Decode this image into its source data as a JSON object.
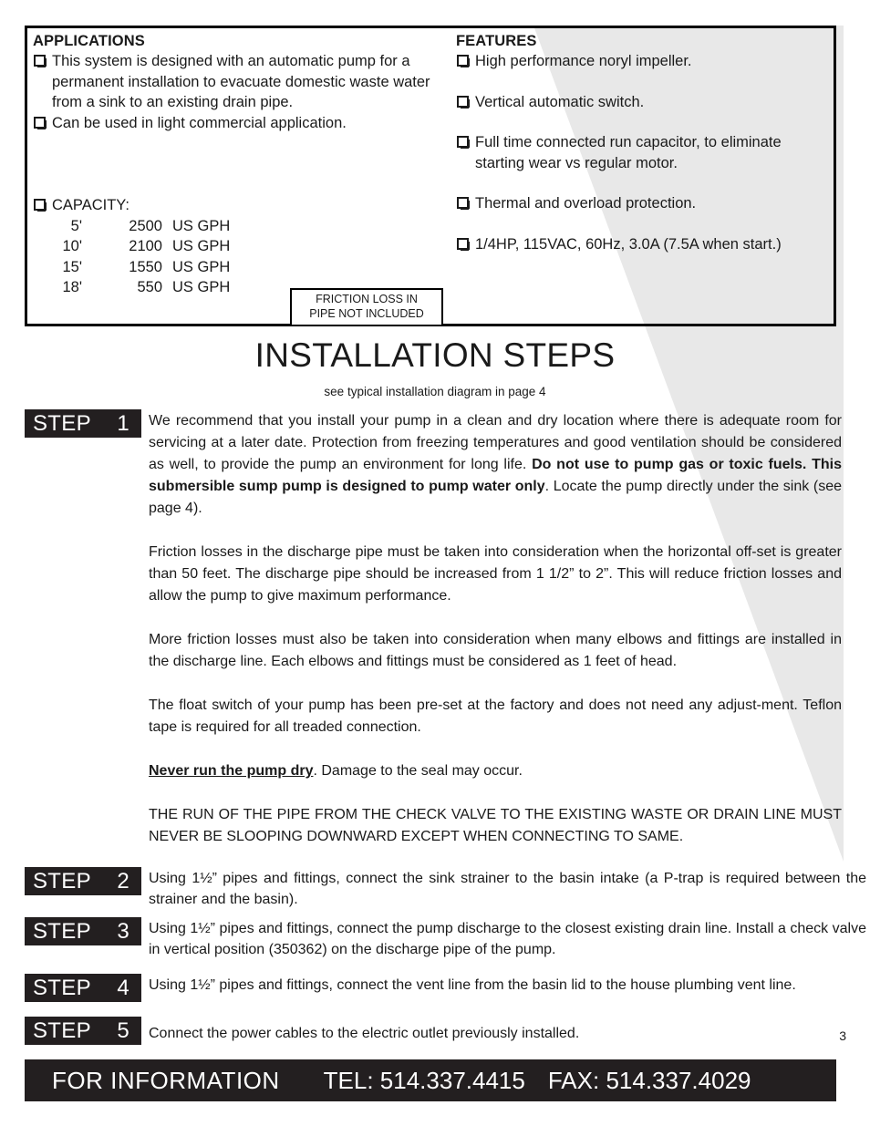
{
  "spec_box": {
    "applications": {
      "heading": "APPLICATIONS",
      "items": [
        "This system is designed with an automatic pump for a permanent installation to evacuate domestic waste water from a sink to an existing drain pipe.",
        "Can be used in light commercial application."
      ],
      "capacity_label": "CAPACITY:",
      "capacity_rows": [
        {
          "head": "5'",
          "value": "2500",
          "unit": "US GPH"
        },
        {
          "head": "10'",
          "value": "2100",
          "unit": "US GPH"
        },
        {
          "head": "15'",
          "value": "1550",
          "unit": "US GPH"
        },
        {
          "head": "18'",
          "value": "550",
          "unit": "US GPH"
        }
      ],
      "friction_note_line1": "FRICTION LOSS IN",
      "friction_note_line2": "PIPE NOT INCLUDED"
    },
    "features": {
      "heading": "FEATURES",
      "items": [
        "High performance noryl impeller.",
        "Vertical automatic switch.",
        "Full time connected run capacitor, to eliminate starting wear vs regular motor.",
        "Thermal and overload protection.",
        "1/4HP, 115VAC, 60Hz, 3.0A (7.5A when start.)"
      ]
    }
  },
  "title": {
    "main": "INSTALLATION STEPS",
    "sub": "see typical installation diagram in page 4"
  },
  "steps": {
    "word": "STEP",
    "step1": {
      "number": "1",
      "paragraphs": [
        {
          "runs": [
            {
              "text": "We recommend that you install your pump in a clean and dry location where there is adequate room for servicing at a later date. Protection from freezing temperatures and good ventilation should be considered as well, to provide the pump an environment for long life. ",
              "style": "normal"
            },
            {
              "text": "Do not use to pump gas or toxic fuels. This submersible sump pump is designed to pump water only",
              "style": "bold"
            },
            {
              "text": ". Locate the pump directly under the sink (see page 4).",
              "style": "normal"
            }
          ]
        },
        {
          "runs": [
            {
              "text": "Friction losses in the discharge pipe must be taken into consideration when the horizontal off-set is greater than 50 feet. The discharge pipe should be increased from 1 1/2” to 2”. This will reduce friction losses and allow the pump to give maximum performance.",
              "style": "normal"
            }
          ]
        },
        {
          "runs": [
            {
              "text": "More friction losses must also be taken into consideration when many elbows and fittings are installed in the discharge line. Each elbows and fittings must be considered as 1 feet of head.",
              "style": "normal"
            }
          ]
        },
        {
          "runs": [
            {
              "text": "The float switch of your pump has been pre-set at the factory and does not need any adjust-ment. Teflon tape is required for all treaded connection.",
              "style": "normal"
            }
          ]
        },
        {
          "runs": [
            {
              "text": "Never run the pump dry",
              "style": "bold-underline"
            },
            {
              "text": ". Damage to the seal may occur.",
              "style": "normal"
            }
          ]
        },
        {
          "runs": [
            {
              "text": "THE RUN OF THE PIPE FROM THE CHECK VALVE TO THE EXISTING WASTE OR DRAIN LINE MUST NEVER BE SLOOPING DOWNWARD EXCEPT WHEN CONNECTING TO SAME.",
              "style": "normal"
            }
          ]
        }
      ]
    },
    "step2": {
      "number": "2",
      "text": "Using 1½” pipes and fittings, connect the sink strainer to the basin intake (a P-trap is required between the strainer and the basin)."
    },
    "step3": {
      "number": "3",
      "text": "Using 1½” pipes and fittings, connect the pump discharge to the closest existing drain line. Install a check valve in vertical position (350362) on the discharge pipe of the pump."
    },
    "step4": {
      "number": "4",
      "text": "Using 1½” pipes and fittings, connect the vent line from the basin lid to the house plumbing vent line."
    },
    "step5": {
      "number": "5",
      "text": "Connect the power cables to the electric outlet previously installed."
    }
  },
  "page_number": "3",
  "footer": {
    "information": "FOR  INFORMATION",
    "tel": "TEL: 514.337.4415",
    "fax": "FAX: 514.337.4029"
  },
  "colors": {
    "ink": "#231f20",
    "shade": "#e8e8e8",
    "paper": "#ffffff"
  }
}
